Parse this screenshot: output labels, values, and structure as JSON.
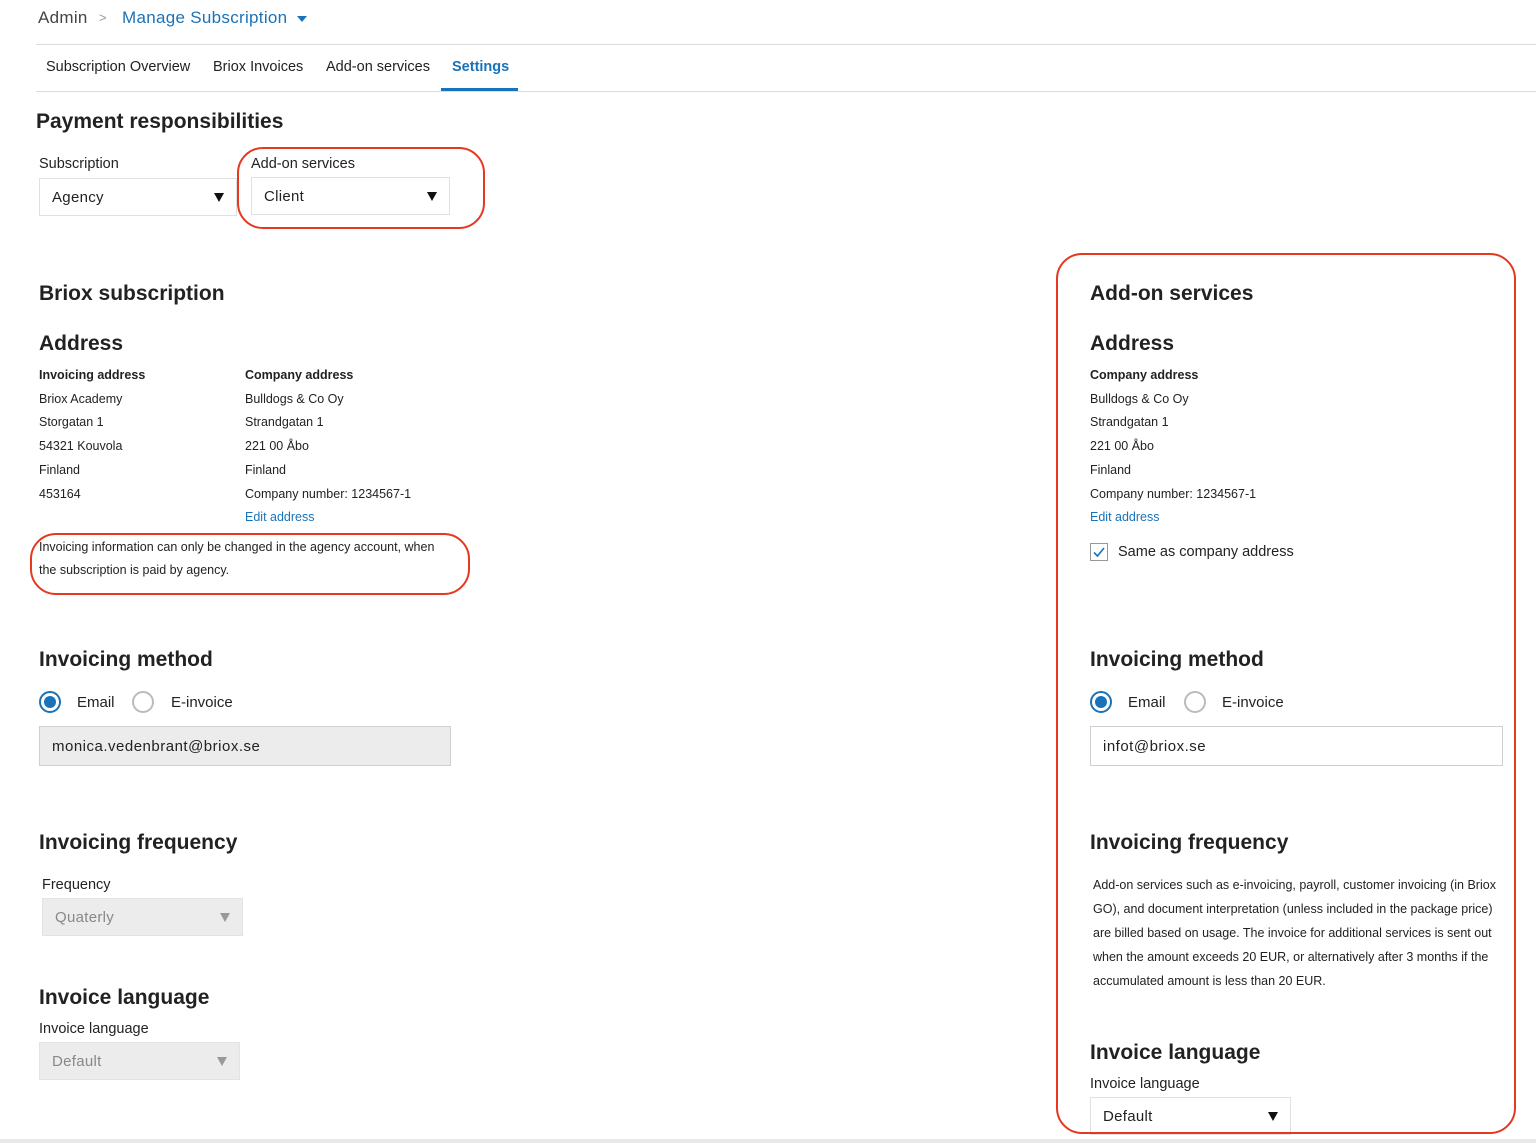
{
  "breadcrumb": {
    "root": "Admin",
    "separator": ">",
    "current": "Manage Subscription"
  },
  "tabs": [
    "Subscription Overview",
    "Briox Invoices",
    "Add-on services",
    "Settings"
  ],
  "payment": {
    "title": "Payment responsibilities",
    "subscription_label": "Subscription",
    "subscription_value": "Agency",
    "addon_label": "Add-on services",
    "addon_value": "Client"
  },
  "left": {
    "title": "Briox subscription",
    "address_title": "Address",
    "invoicing_address": {
      "heading": "Invoicing address",
      "lines": [
        "Briox Academy",
        "Storgatan 1",
        "54321 Kouvola",
        "Finland",
        "453164"
      ]
    },
    "company_address": {
      "heading": "Company address",
      "lines": [
        "Bulldogs & Co Oy",
        "Strandgatan 1",
        "221 00 Åbo",
        "Finland",
        "Company number: 1234567-1"
      ],
      "edit": "Edit address"
    },
    "notice_line1": "Invoicing information can only be changed in the agency account, when",
    "notice_line2": "the subscription is paid by agency.",
    "method_title": "Invoicing method",
    "method_email": "Email",
    "method_einvoice": "E-invoice",
    "email_value": "monica.vedenbrant@briox.se",
    "frequency_title": "Invoicing frequency",
    "frequency_label": "Frequency",
    "frequency_value": "Quaterly",
    "language_title": "Invoice language",
    "language_label": "Invoice language",
    "language_value": "Default"
  },
  "right": {
    "title": "Add-on services",
    "address_title": "Address",
    "company_address": {
      "heading": "Company address",
      "lines": [
        "Bulldogs & Co Oy",
        "Strandgatan 1",
        "221 00 Åbo",
        "Finland",
        "Company number: 1234567-1"
      ],
      "edit": "Edit address"
    },
    "same_as_company": "Same as company address",
    "same_as_company_checked": true,
    "method_title": "Invoicing method",
    "method_email": "Email",
    "method_einvoice": "E-invoice",
    "email_value": "infot@briox.se",
    "frequency_title": "Invoicing frequency",
    "frequency_text": [
      "Add-on services such as e-invoicing, payroll, customer invoicing (in Briox",
      "GO), and document interpretation (unless included in the package price)",
      "are billed based on usage. The invoice for additional services is sent out",
      "when the amount exceeds 20 EUR, or alternatively after 3 months if the",
      "accumulated amount is less than 20 EUR."
    ],
    "language_title": "Invoice language",
    "language_label": "Invoice language",
    "language_value": "Default"
  },
  "colors": {
    "accent": "#1a73b8",
    "annotation": "#e6371f"
  },
  "icons": {
    "dropdown": "triangle-down-icon",
    "breadcrumb_caret": "caret-down-icon",
    "check": "check-icon"
  }
}
